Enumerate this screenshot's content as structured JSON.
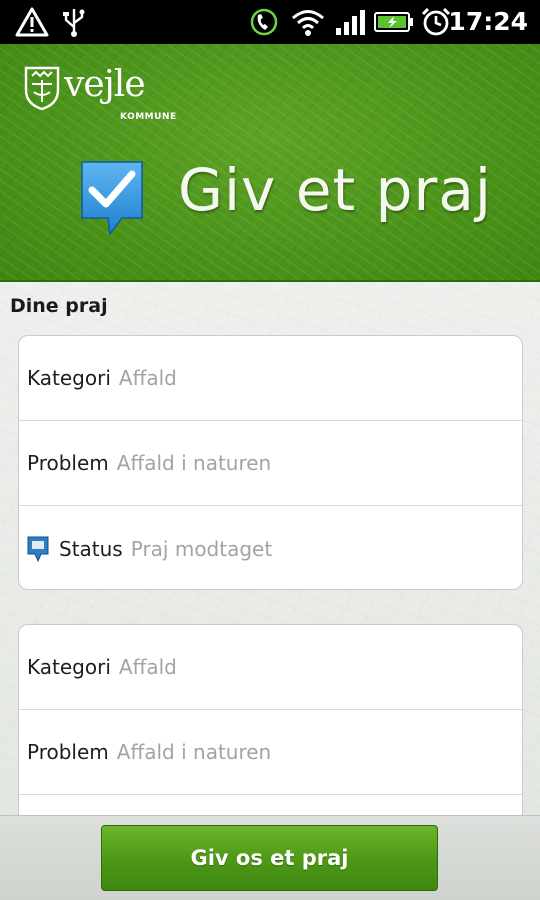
{
  "status_bar": {
    "time": "17:24",
    "icons": [
      "warning-icon",
      "usb-icon",
      "sync-phone-icon",
      "wifi-icon",
      "signal-icon",
      "battery-charging-icon",
      "alarm-clock-icon"
    ]
  },
  "header": {
    "logo_name": "vejle",
    "logo_sub": "KOMMUNE",
    "app_title": "Giv et praj",
    "brand_color": "#4b9419"
  },
  "section": {
    "title": "Dine praj"
  },
  "cards": [
    {
      "rows": [
        {
          "label": "Kategori",
          "value": "Affald"
        },
        {
          "label": "Problem",
          "value": "Affald i naturen"
        },
        {
          "label": "Status",
          "value": "Praj modtaget",
          "icon": "status-marker-icon"
        }
      ]
    },
    {
      "rows": [
        {
          "label": "Kategori",
          "value": "Affald"
        },
        {
          "label": "Problem",
          "value": "Affald i naturen"
        }
      ]
    }
  ],
  "cta": {
    "label": "Giv os et praj"
  }
}
